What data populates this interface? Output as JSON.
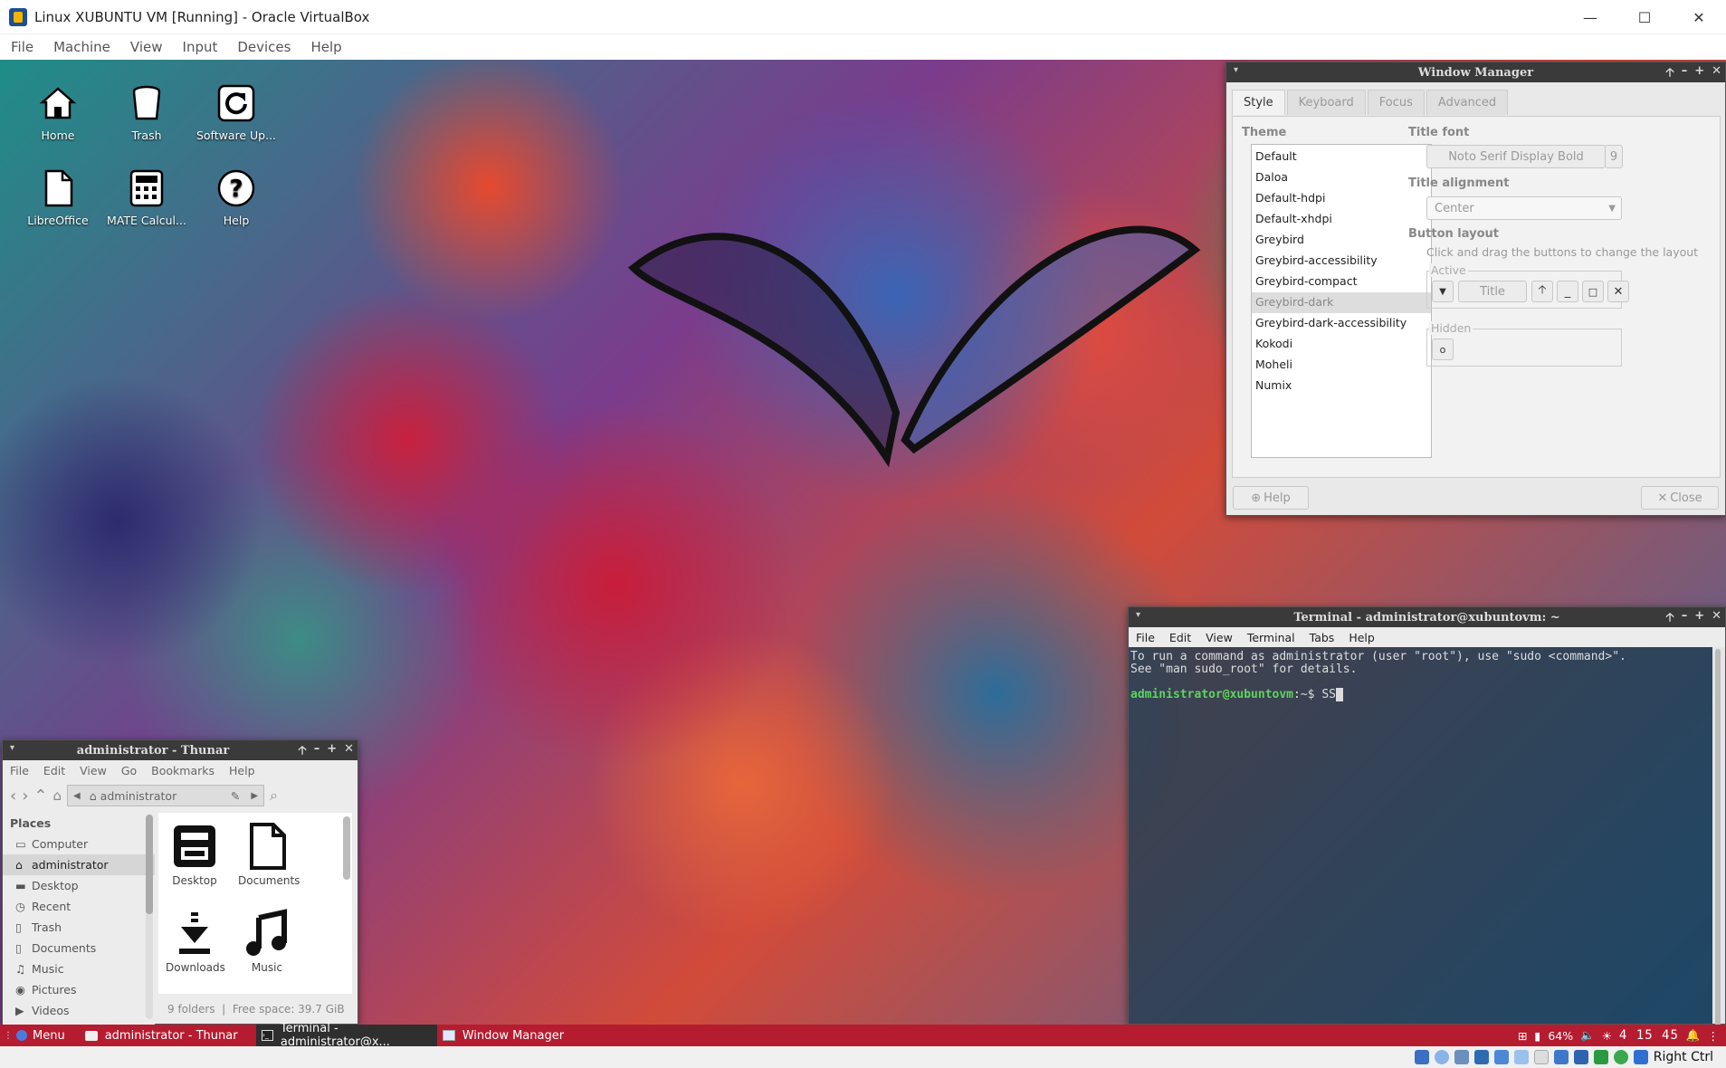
{
  "host": {
    "title": "Linux XUBUNTU VM [Running] - Oracle VirtualBox",
    "controls": {
      "minimize": "—",
      "maximize": "☐",
      "close": "✕"
    },
    "menu": [
      "File",
      "Machine",
      "View",
      "Input",
      "Devices",
      "Help"
    ],
    "status_right": "Right Ctrl"
  },
  "desktop_icons": [
    {
      "label": "Home",
      "icon": "home-icon"
    },
    {
      "label": "Trash",
      "icon": "trash-icon"
    },
    {
      "label": "Software Up...",
      "icon": "software-update-icon"
    },
    {
      "label": "LibreOffice",
      "icon": "document-icon"
    },
    {
      "label": "MATE Calcul...",
      "icon": "calculator-icon"
    },
    {
      "label": "Help",
      "icon": "help-icon"
    }
  ],
  "wm": {
    "title": "Window Manager",
    "tabs": [
      "Style",
      "Keyboard",
      "Focus",
      "Advanced"
    ],
    "theme_label": "Theme",
    "themes": [
      "Default",
      "Daloa",
      "Default-hdpi",
      "Default-xhdpi",
      "Greybird",
      "Greybird-accessibility",
      "Greybird-compact",
      "Greybird-dark",
      "Greybird-dark-accessibility",
      "Kokodi",
      "Moheli",
      "Numix"
    ],
    "selected_theme": "Greybird-dark",
    "title_font_label": "Title font",
    "title_font": "Noto Serif Display Bold",
    "title_font_size": "9",
    "title_alignment_label": "Title alignment",
    "title_alignment": "Center",
    "button_layout_label": "Button layout",
    "button_layout_hint": "Click and drag the buttons to change the layout",
    "active_label": "Active",
    "active_title": "Title",
    "hidden_label": "Hidden",
    "help_btn": "Help",
    "close_btn": "Close"
  },
  "terminal": {
    "title": "Terminal - administrator@xubuntovm: ~",
    "menu": [
      "File",
      "Edit",
      "View",
      "Terminal",
      "Tabs",
      "Help"
    ],
    "line1": "To run a command as administrator (user \"root\"), use \"sudo <command>\".",
    "line2": "See \"man sudo_root\" for details.",
    "prompt_user": "administrator@xubuntovm",
    "prompt_rest": ":~$ ",
    "input": "SS"
  },
  "thunar": {
    "title": "administrator - Thunar",
    "menu": [
      "File",
      "Edit",
      "View",
      "Go",
      "Bookmarks",
      "Help"
    ],
    "location": "administrator",
    "places_label": "Places",
    "places": [
      {
        "label": "Computer",
        "icon": "computer-icon"
      },
      {
        "label": "administrator",
        "icon": "home-icon"
      },
      {
        "label": "Desktop",
        "icon": "folder-icon"
      },
      {
        "label": "Recent",
        "icon": "clock-icon"
      },
      {
        "label": "Trash",
        "icon": "trash-icon"
      },
      {
        "label": "Documents",
        "icon": "document-icon"
      },
      {
        "label": "Music",
        "icon": "music-icon"
      },
      {
        "label": "Pictures",
        "icon": "picture-icon"
      },
      {
        "label": "Videos",
        "icon": "video-icon"
      }
    ],
    "selected_place": "administrator",
    "files": [
      {
        "label": "Desktop",
        "icon": "desktop-folder-icon"
      },
      {
        "label": "Documents",
        "icon": "document-icon"
      },
      {
        "label": "Downloads",
        "icon": "download-icon"
      },
      {
        "label": "Music",
        "icon": "music-icon"
      }
    ],
    "status": "9 folders  |  Free space: 39.7 GiB"
  },
  "taskbar": {
    "menu_label": "Menu",
    "items": [
      {
        "label": "administrator - Thunar",
        "active": false
      },
      {
        "label": "Terminal - administrator@x...",
        "active": true
      },
      {
        "label": "Window Manager",
        "active": false
      }
    ],
    "battery": "64%",
    "clock": "4 15 45"
  }
}
